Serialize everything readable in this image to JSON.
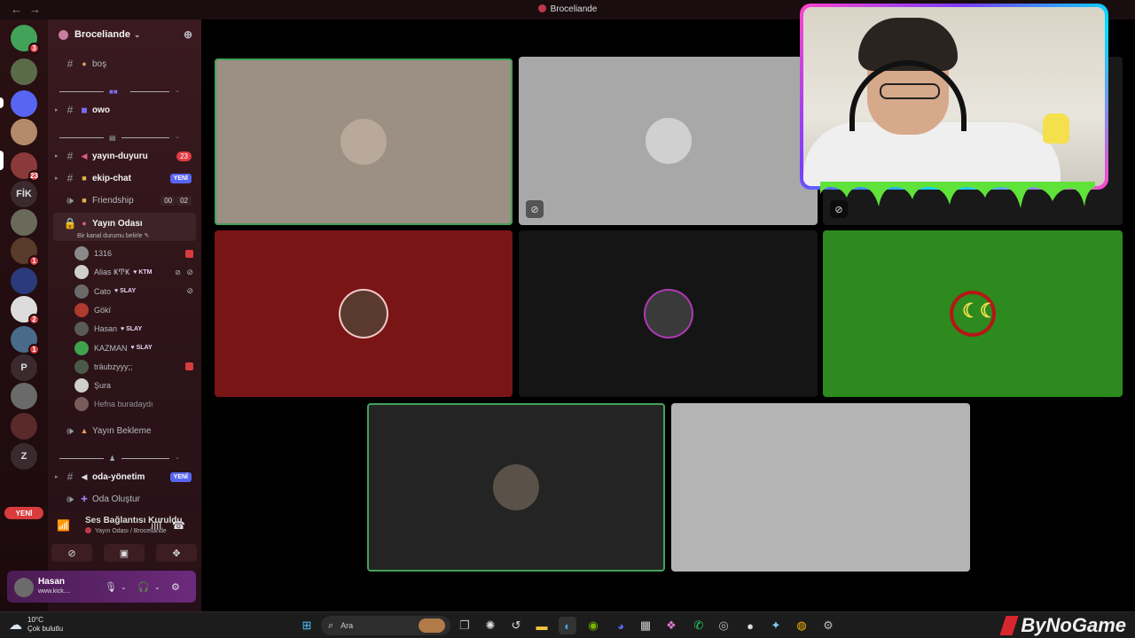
{
  "window": {
    "title": "Broceliande"
  },
  "rail": {
    "servers": [
      {
        "label": "",
        "badge": "3",
        "color": "#43a25a"
      },
      {
        "label": "",
        "badge": "",
        "color": "#5a6b4a"
      },
      {
        "label": "",
        "badge": "",
        "color": "#5865f2"
      },
      {
        "label": "",
        "badge": "",
        "color": "#b38a6a"
      },
      {
        "label": "",
        "badge": "23",
        "color": "#8a3a3a"
      },
      {
        "label": "FİK",
        "badge": "",
        "color": "#3a2a2e"
      },
      {
        "label": "",
        "badge": "",
        "color": "#6a6a5a"
      },
      {
        "label": "",
        "badge": "1",
        "color": "#5a3a2a"
      },
      {
        "label": "",
        "badge": "",
        "color": "#2a3a7a"
      },
      {
        "label": "",
        "badge": "2",
        "color": "#dcdcdc"
      },
      {
        "label": "",
        "badge": "1",
        "color": "#4a6a8a"
      },
      {
        "label": "P",
        "badge": "",
        "color": "#3a2a2e"
      },
      {
        "label": "",
        "badge": "",
        "color": "#6a6a6a"
      },
      {
        "label": "",
        "badge": "",
        "color": "#5a2a2a"
      },
      {
        "label": "Z",
        "badge": "",
        "color": "#3a2a2e"
      }
    ],
    "new_label": "YENİ"
  },
  "guild": {
    "name": "Broceliande"
  },
  "channels": {
    "bos": "boş",
    "owo": "owo",
    "yayin_duyuru": "yayın-duyuru",
    "yayin_duyuru_count": "23",
    "ekip_chat": "ekip-chat",
    "ekip_chat_badge": "YENİ",
    "friendship": "Friendship",
    "friendship_limit_a": "00",
    "friendship_limit_b": "02",
    "yayin_odasi": "Yayın Odası",
    "yayin_odasi_desc": "Bir kanal durumu belirle",
    "yayin_bekleme": "Yayın Bekleme",
    "oda_yonetim": "oda-yönetim",
    "oda_yonetim_badge": "YENİ",
    "oda_olustur": "Oda Oluştur"
  },
  "voice_users": [
    {
      "name": "1316",
      "tag": "",
      "rec": true,
      "icons": "",
      "color": "#8a8a8a"
    },
    {
      "name": "Alias ҜͲҜ",
      "tag": "KTM",
      "rec": false,
      "icons": "mute-deaf",
      "color": "#cfcfcf"
    },
    {
      "name": "Cato",
      "tag": "SLAY",
      "rec": false,
      "icons": "mute",
      "color": "#6a6a6a"
    },
    {
      "name": "Gökï",
      "tag": "",
      "rec": false,
      "icons": "",
      "color": "#b03a2e"
    },
    {
      "name": "Hasan",
      "tag": "SLAY",
      "rec": false,
      "icons": "",
      "color": "#5a5a5a"
    },
    {
      "name": "KAZMAN",
      "tag": "SLAY",
      "rec": false,
      "icons": "",
      "color": "#3fa34d"
    },
    {
      "name": "träubzyyy;;",
      "tag": "",
      "rec": true,
      "icons": "",
      "color": "#4a5a4a"
    },
    {
      "name": "Şura",
      "tag": "",
      "rec": false,
      "icons": "",
      "color": "#cfcfcf"
    },
    {
      "name": "Hefna buradaydı",
      "tag": "",
      "rec": false,
      "icons": "",
      "color": "#7a5a5a"
    }
  ],
  "voice_status": {
    "title": "Ses Bağlantısı Kuruldu",
    "subtitle": "Yayın Odası / Broceliande"
  },
  "user": {
    "name": "Hasan",
    "status": "www.kick...."
  },
  "tiles": [
    {
      "bg": "#9c8f84",
      "speaking": true,
      "avatar": "#b8a99a",
      "ring": "",
      "overlay_icon": ""
    },
    {
      "bg": "#a8a8a8",
      "speaking": false,
      "avatar": "#d0d0d0",
      "ring": "",
      "overlay_icon": "mic-off"
    },
    {
      "bg": "#7a1516",
      "speaking": false,
      "avatar": "#5a3a2e",
      "ring": "#f2c9c9",
      "overlay_icon": ""
    },
    {
      "bg": "#151515",
      "speaking": false,
      "avatar": "#3a3a3a",
      "ring": "#b03ab5",
      "overlay_icon": ""
    },
    {
      "bg": "#2c8a1e",
      "speaking": false,
      "avatar": "#b51616",
      "ring": "",
      "overlay_icon": ""
    },
    {
      "bg": "#242424",
      "speaking": true,
      "avatar": "#5a5248",
      "ring": "",
      "overlay_icon": ""
    },
    {
      "bg": "#b4b4b4",
      "speaking": false,
      "avatar": "#b4b4b4",
      "ring": "",
      "overlay_icon": ""
    },
    {
      "bg": "#191919",
      "speaking": false,
      "avatar": "",
      "ring": "",
      "overlay_icon": "mic-off"
    }
  ],
  "taskbar": {
    "temp": "10°C",
    "weather": "Çok bulutlu",
    "search_placeholder": "Ara",
    "brand": "ByNoGame"
  }
}
